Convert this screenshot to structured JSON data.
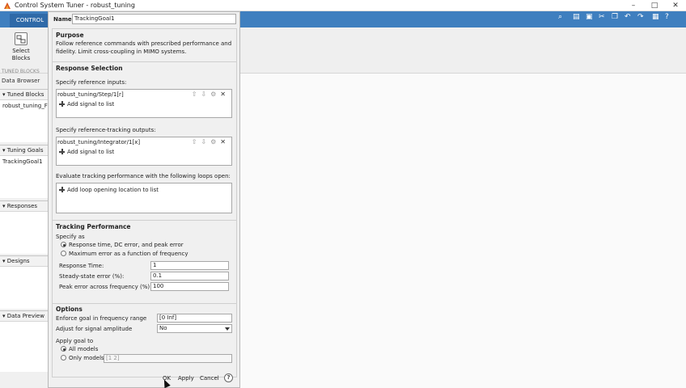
{
  "window": {
    "title": "Control System Tuner - robust_tuning",
    "minimize": "–",
    "maximize": "□",
    "close": "✕"
  },
  "ribbon": {
    "tab_label": "CONTROL",
    "select_blocks_label": "Select Blocks",
    "tuned_blocks_group": "TUNED BLOCKS"
  },
  "browser": {
    "tab_label": "Data Browser",
    "sections": [
      {
        "title": "Tuned Blocks",
        "items": [
          "robust_tuning_F"
        ]
      },
      {
        "title": "Tuning Goals",
        "items": [
          "TrackingGoal1"
        ]
      },
      {
        "title": "Responses",
        "items": []
      },
      {
        "title": "Designs",
        "items": []
      },
      {
        "title": "Data Preview",
        "items": []
      }
    ]
  },
  "dialog": {
    "name_label": "Name:",
    "name_value": "TrackingGoal1",
    "purpose_title": "Purpose",
    "purpose_line1": "Follow reference commands with prescribed performance and",
    "purpose_line2": "fidelity. Limit cross-coupling in MIMO systems.",
    "response_title": "Response Selection",
    "ref_inputs_label": "Specify reference inputs:",
    "ref_inputs_entry": "robust_tuning/Step/1[r]",
    "add_signal": "Add signal to list",
    "outputs_label": "Specify reference-tracking outputs:",
    "outputs_entry": "robust_tuning/Integrator/1[x]",
    "loops_label": "Evaluate tracking performance with the following loops open:",
    "add_loop": "Add loop opening location to list",
    "perf_title": "Tracking Performance",
    "specify_as": "Specify as",
    "radio_response": "Response time, DC error, and peak error",
    "radio_max_error": "Maximum error as a function of frequency",
    "response_time_label": "Response Time:",
    "response_time_value": "1",
    "steady_state_label": "Steady-state error (%):",
    "steady_state_value": "0.1",
    "peak_error_label": "Peak error across frequency (%):",
    "peak_error_value": "100",
    "options_title": "Options",
    "freq_range_label": "Enforce goal in frequency range",
    "freq_range_value": "[0 Inf]",
    "amplitude_label": "Adjust for signal amplitude",
    "amplitude_value": "No",
    "apply_goal_label": "Apply goal to",
    "all_models": "All models",
    "only_models": "Only models:",
    "only_models_value": "[1 2]",
    "ok": "OK",
    "apply": "Apply",
    "cancel": "Cancel",
    "help": "?"
  },
  "colors": {
    "ribbon_blue": "#3f7fbf",
    "tab_blue": "#2f6aa8",
    "dialog_bg": "#f0f0f0"
  }
}
